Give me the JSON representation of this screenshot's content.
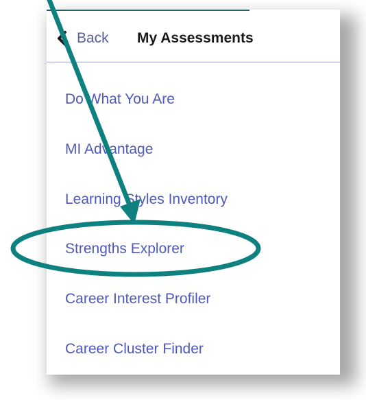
{
  "header": {
    "back_label": "Back",
    "title": "My Assessments"
  },
  "menu": {
    "items": [
      {
        "label": "Do What You Are"
      },
      {
        "label": "MI Advantage"
      },
      {
        "label": "Learning Styles Inventory"
      },
      {
        "label": "Strengths Explorer"
      },
      {
        "label": "Career Interest Profiler"
      },
      {
        "label": "Career Cluster Finder"
      }
    ]
  },
  "annotation": {
    "highlighted_item": "Strengths Explorer",
    "color": "#0f8080"
  },
  "colors": {
    "link": "#4f58b8",
    "back_link": "#5a5f9a",
    "title": "#1a1a1a",
    "divider": "#9aa0c8",
    "shadow": "#9a9a9a"
  }
}
